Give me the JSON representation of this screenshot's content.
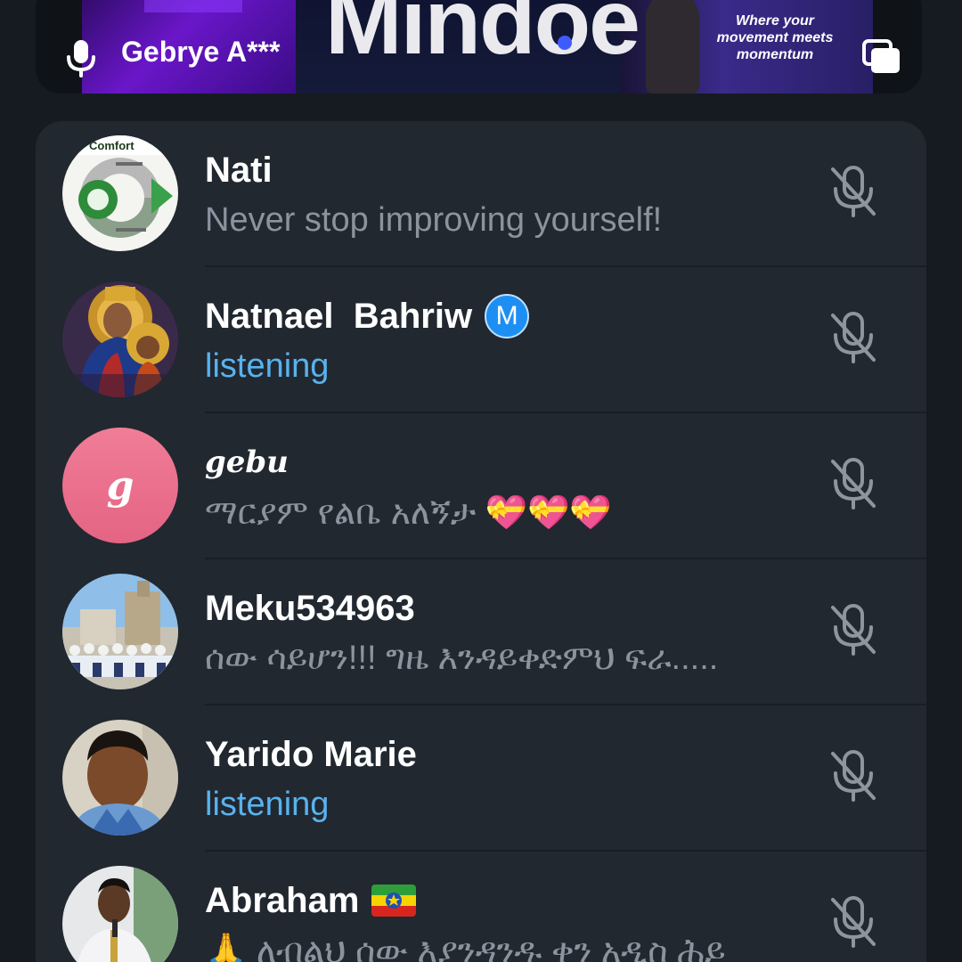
{
  "video_strip": {
    "brand_text": "Mindoe",
    "promo_text": "Where your movement meets momentum",
    "speaker_name": "Gebrye A***",
    "icons": {
      "mic": "mic-icon",
      "pip": "picture-in-picture-icon"
    }
  },
  "participants": [
    {
      "name": "Nati",
      "status": "Never stop improving yourself!",
      "status_type": "bio",
      "avatar": "comfort-zone-diagram-avatar",
      "badge": null,
      "mic": "muted"
    },
    {
      "name": "Natnael  Bahriw",
      "status": "listening",
      "status_type": "active",
      "avatar": "religious-icon-avatar",
      "badge": "M",
      "mic": "muted"
    },
    {
      "name": "gebu",
      "status": "ማርያም የልቤ አለኝታ 💝💝💝",
      "status_type": "bio",
      "avatar": "letter-g-avatar",
      "avatar_letter": "g",
      "avatar_color": "#ea6f8a",
      "badge": null,
      "mic": "muted"
    },
    {
      "name": "Meku534963",
      "status": "ሰው ሳይሆን!!! ግዜ እንዳይቀድምህ ፍራ.....",
      "status_type": "bio",
      "avatar": "group-photo-avatar",
      "badge": null,
      "mic": "muted"
    },
    {
      "name": "Yarido Marie",
      "status": "listening",
      "status_type": "active",
      "avatar": "portrait-avatar",
      "badge": null,
      "mic": "muted"
    },
    {
      "name": "Abraham",
      "status": "🙏 ለብልህ ሰው እያንዳንዱ ቀን አዲስ ሕይ",
      "status_type": "bio",
      "avatar": "speaker-photo-avatar",
      "badge": "ethiopia-flag",
      "mic": "muted"
    }
  ],
  "colors": {
    "background": "#161b21",
    "card": "#212830",
    "accent_active": "#59b2ee",
    "muted_text": "#8b949e",
    "icon_muted": "#8d959e",
    "badge_blue": "#1e8ff2"
  }
}
